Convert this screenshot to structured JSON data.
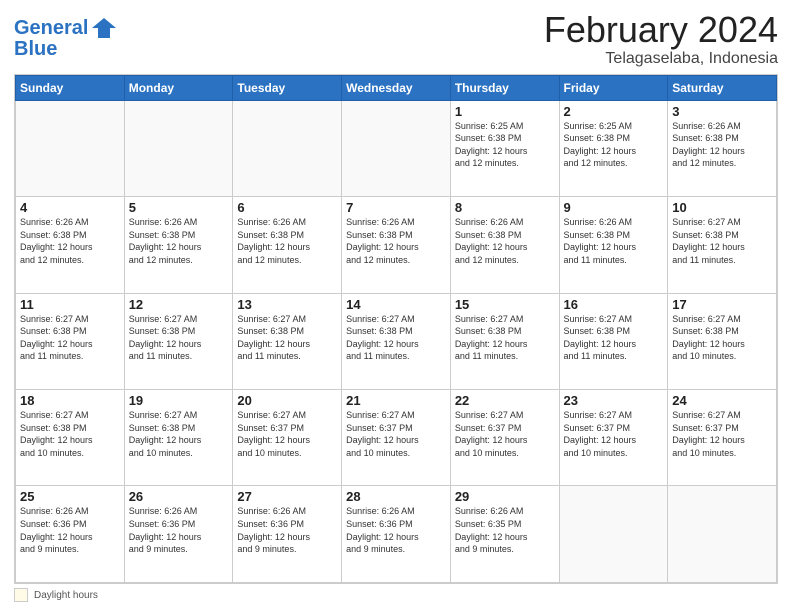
{
  "header": {
    "logo_line1": "General",
    "logo_line2": "Blue",
    "main_title": "February 2024",
    "subtitle": "Telagaselaba, Indonesia"
  },
  "days_of_week": [
    "Sunday",
    "Monday",
    "Tuesday",
    "Wednesday",
    "Thursday",
    "Friday",
    "Saturday"
  ],
  "weeks": [
    [
      {
        "day": "",
        "info": ""
      },
      {
        "day": "",
        "info": ""
      },
      {
        "day": "",
        "info": ""
      },
      {
        "day": "",
        "info": ""
      },
      {
        "day": "1",
        "info": "Sunrise: 6:25 AM\nSunset: 6:38 PM\nDaylight: 12 hours\nand 12 minutes."
      },
      {
        "day": "2",
        "info": "Sunrise: 6:25 AM\nSunset: 6:38 PM\nDaylight: 12 hours\nand 12 minutes."
      },
      {
        "day": "3",
        "info": "Sunrise: 6:26 AM\nSunset: 6:38 PM\nDaylight: 12 hours\nand 12 minutes."
      }
    ],
    [
      {
        "day": "4",
        "info": "Sunrise: 6:26 AM\nSunset: 6:38 PM\nDaylight: 12 hours\nand 12 minutes."
      },
      {
        "day": "5",
        "info": "Sunrise: 6:26 AM\nSunset: 6:38 PM\nDaylight: 12 hours\nand 12 minutes."
      },
      {
        "day": "6",
        "info": "Sunrise: 6:26 AM\nSunset: 6:38 PM\nDaylight: 12 hours\nand 12 minutes."
      },
      {
        "day": "7",
        "info": "Sunrise: 6:26 AM\nSunset: 6:38 PM\nDaylight: 12 hours\nand 12 minutes."
      },
      {
        "day": "8",
        "info": "Sunrise: 6:26 AM\nSunset: 6:38 PM\nDaylight: 12 hours\nand 12 minutes."
      },
      {
        "day": "9",
        "info": "Sunrise: 6:26 AM\nSunset: 6:38 PM\nDaylight: 12 hours\nand 11 minutes."
      },
      {
        "day": "10",
        "info": "Sunrise: 6:27 AM\nSunset: 6:38 PM\nDaylight: 12 hours\nand 11 minutes."
      }
    ],
    [
      {
        "day": "11",
        "info": "Sunrise: 6:27 AM\nSunset: 6:38 PM\nDaylight: 12 hours\nand 11 minutes."
      },
      {
        "day": "12",
        "info": "Sunrise: 6:27 AM\nSunset: 6:38 PM\nDaylight: 12 hours\nand 11 minutes."
      },
      {
        "day": "13",
        "info": "Sunrise: 6:27 AM\nSunset: 6:38 PM\nDaylight: 12 hours\nand 11 minutes."
      },
      {
        "day": "14",
        "info": "Sunrise: 6:27 AM\nSunset: 6:38 PM\nDaylight: 12 hours\nand 11 minutes."
      },
      {
        "day": "15",
        "info": "Sunrise: 6:27 AM\nSunset: 6:38 PM\nDaylight: 12 hours\nand 11 minutes."
      },
      {
        "day": "16",
        "info": "Sunrise: 6:27 AM\nSunset: 6:38 PM\nDaylight: 12 hours\nand 11 minutes."
      },
      {
        "day": "17",
        "info": "Sunrise: 6:27 AM\nSunset: 6:38 PM\nDaylight: 12 hours\nand 10 minutes."
      }
    ],
    [
      {
        "day": "18",
        "info": "Sunrise: 6:27 AM\nSunset: 6:38 PM\nDaylight: 12 hours\nand 10 minutes."
      },
      {
        "day": "19",
        "info": "Sunrise: 6:27 AM\nSunset: 6:38 PM\nDaylight: 12 hours\nand 10 minutes."
      },
      {
        "day": "20",
        "info": "Sunrise: 6:27 AM\nSunset: 6:37 PM\nDaylight: 12 hours\nand 10 minutes."
      },
      {
        "day": "21",
        "info": "Sunrise: 6:27 AM\nSunset: 6:37 PM\nDaylight: 12 hours\nand 10 minutes."
      },
      {
        "day": "22",
        "info": "Sunrise: 6:27 AM\nSunset: 6:37 PM\nDaylight: 12 hours\nand 10 minutes."
      },
      {
        "day": "23",
        "info": "Sunrise: 6:27 AM\nSunset: 6:37 PM\nDaylight: 12 hours\nand 10 minutes."
      },
      {
        "day": "24",
        "info": "Sunrise: 6:27 AM\nSunset: 6:37 PM\nDaylight: 12 hours\nand 10 minutes."
      }
    ],
    [
      {
        "day": "25",
        "info": "Sunrise: 6:26 AM\nSunset: 6:36 PM\nDaylight: 12 hours\nand 9 minutes."
      },
      {
        "day": "26",
        "info": "Sunrise: 6:26 AM\nSunset: 6:36 PM\nDaylight: 12 hours\nand 9 minutes."
      },
      {
        "day": "27",
        "info": "Sunrise: 6:26 AM\nSunset: 6:36 PM\nDaylight: 12 hours\nand 9 minutes."
      },
      {
        "day": "28",
        "info": "Sunrise: 6:26 AM\nSunset: 6:36 PM\nDaylight: 12 hours\nand 9 minutes."
      },
      {
        "day": "29",
        "info": "Sunrise: 6:26 AM\nSunset: 6:35 PM\nDaylight: 12 hours\nand 9 minutes."
      },
      {
        "day": "",
        "info": ""
      },
      {
        "day": "",
        "info": ""
      }
    ]
  ],
  "legend": {
    "daylight_label": "Daylight hours"
  }
}
